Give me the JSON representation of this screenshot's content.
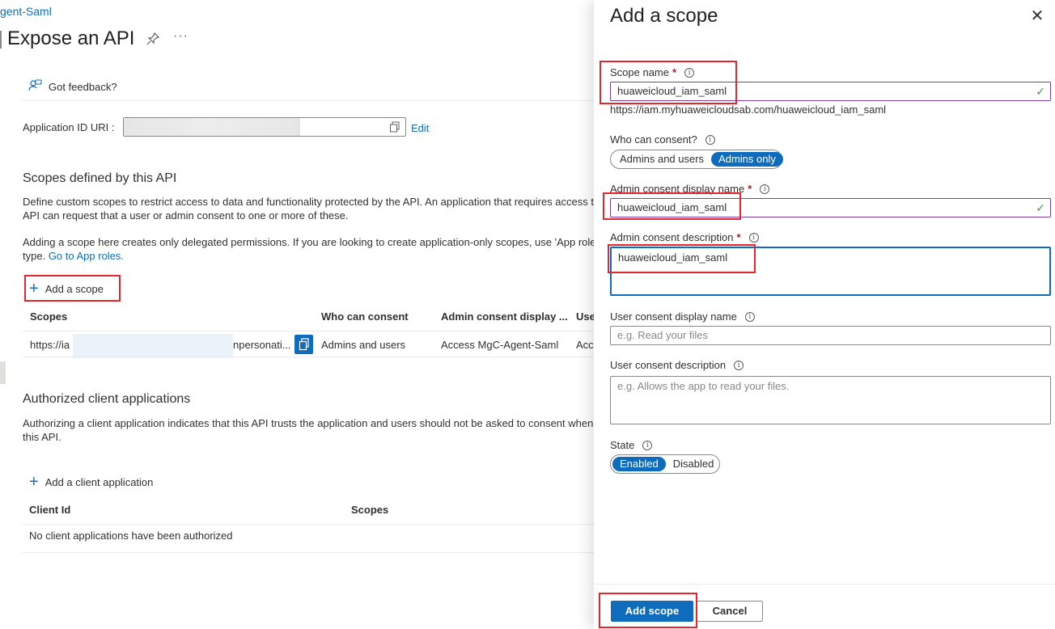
{
  "breadcrumb": "gent-Saml",
  "page": {
    "title": "Expose an API",
    "more": "···",
    "feedback_label": "Got feedback?",
    "app_id_label": "Application ID URI :",
    "edit_label": "Edit",
    "scopes_heading": "Scopes defined by this API",
    "scopes_desc_line1": "Define custom scopes to restrict access to data and functionality protected by the API. An application that requires access to",
    "scopes_desc_line2": "API can request that a user or admin consent to one or more of these.",
    "scopes_desc2_line1": "Adding a scope here creates only delegated permissions. If you are looking to create application-only scopes, use 'App role",
    "scopes_desc2_prefix": "type.",
    "go_to_app_roles": "Go to App roles.",
    "add_scope_label": "Add a scope",
    "scopes_table": {
      "headers": [
        "Scopes",
        "Who can consent",
        "Admin consent display ...",
        "Use"
      ],
      "row": {
        "scope_prefix": "https://ia",
        "scope_suffix": "npersonati...",
        "who": "Admins and users",
        "admin_display": "Access MgC-Agent-Saml",
        "user_display": "Acc"
      }
    },
    "auth_heading": "Authorized client applications",
    "auth_desc_line1": "Authorizing a client application indicates that this API trusts the application and users should not be asked to consent when",
    "auth_desc_line2": "this API.",
    "add_client_label": "Add a client application",
    "client_table": {
      "headers": [
        "Client Id",
        "Scopes"
      ],
      "empty": "No client applications have been authorized"
    }
  },
  "panel": {
    "title": "Add a scope",
    "close": "✕",
    "scope_name_label": "Scope name",
    "scope_name_value": "huaweicloud_iam_saml",
    "scope_url": "https://iam.myhuaweicloudsab.com/huaweicloud_iam_saml",
    "who_consent_label": "Who can consent?",
    "who_consent_options": [
      "Admins and users",
      "Admins only"
    ],
    "admin_display_label": "Admin consent display name",
    "admin_display_value": "huaweicloud_iam_saml",
    "admin_desc_label": "Admin consent description",
    "admin_desc_value": "huaweicloud_iam_saml",
    "user_display_label": "User consent display name",
    "user_display_placeholder": "e.g. Read your files",
    "user_desc_label": "User consent description",
    "user_desc_placeholder": "e.g. Allows the app to read your files.",
    "state_label": "State",
    "state_options": [
      "Enabled",
      "Disabled"
    ],
    "required_mark": "*",
    "info_glyph": "i",
    "add_button": "Add scope",
    "cancel_button": "Cancel"
  },
  "colors": {
    "accent": "#0f6cbd",
    "highlight": "#e3262f",
    "valid_border": "#7a3fa0",
    "valid_check": "#3d9a3d"
  }
}
